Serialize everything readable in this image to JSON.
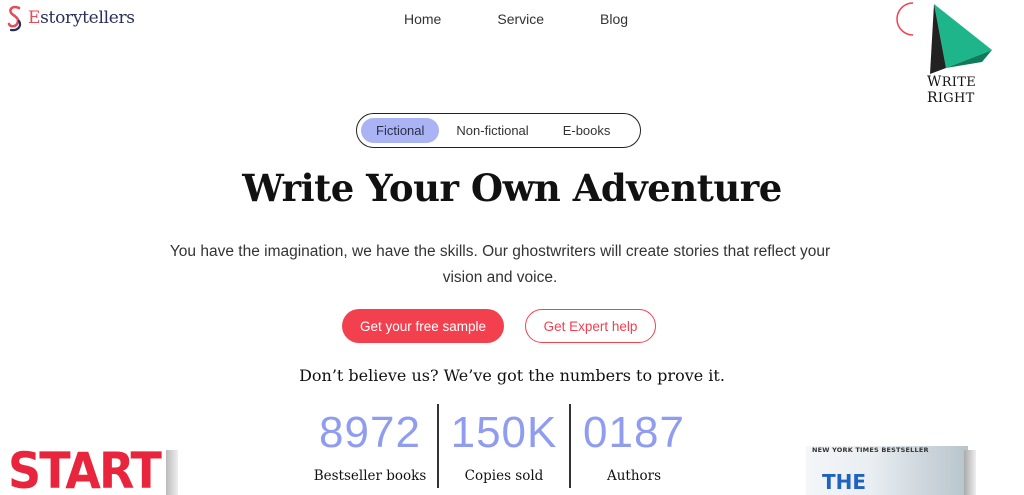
{
  "header": {
    "logo_text_accent": "E",
    "logo_text_rest": "storytellers",
    "nav": [
      "Home",
      "Service",
      "Blog"
    ],
    "brand_right_big": "W",
    "brand_right_small": "RITE ",
    "brand_right_big2": "R",
    "brand_right_small2": "IGHT"
  },
  "tabs": [
    "Fictional",
    "Non-fictional",
    "E-books"
  ],
  "hero": {
    "title": "Write Your Own Adventure",
    "subtitle": "You have the imagination, we have the skills. Our ghostwriters will create stories that reflect your vision and voice.",
    "primary_button": "Get your free sample",
    "secondary_button": "Get Expert help",
    "proof_text": "Don’t believe us? We’ve got the numbers to prove it."
  },
  "stats": [
    {
      "value": "8972",
      "label": "Bestseller books"
    },
    {
      "value": "150K",
      "label": "Copies sold"
    },
    {
      "value": "0187",
      "label": "Authors"
    }
  ],
  "books": {
    "left_cover_text": "START",
    "right_cover_tag": "NEW YORK TIMES BESTSELLER",
    "right_cover_text": "THE"
  },
  "colors": {
    "accent_red": "#f2404f",
    "tab_active": "#aab4f4",
    "stat_blue": "#8f9cf0",
    "brand_navy": "#2a2f5a",
    "brand_green": "#1fb58a"
  }
}
